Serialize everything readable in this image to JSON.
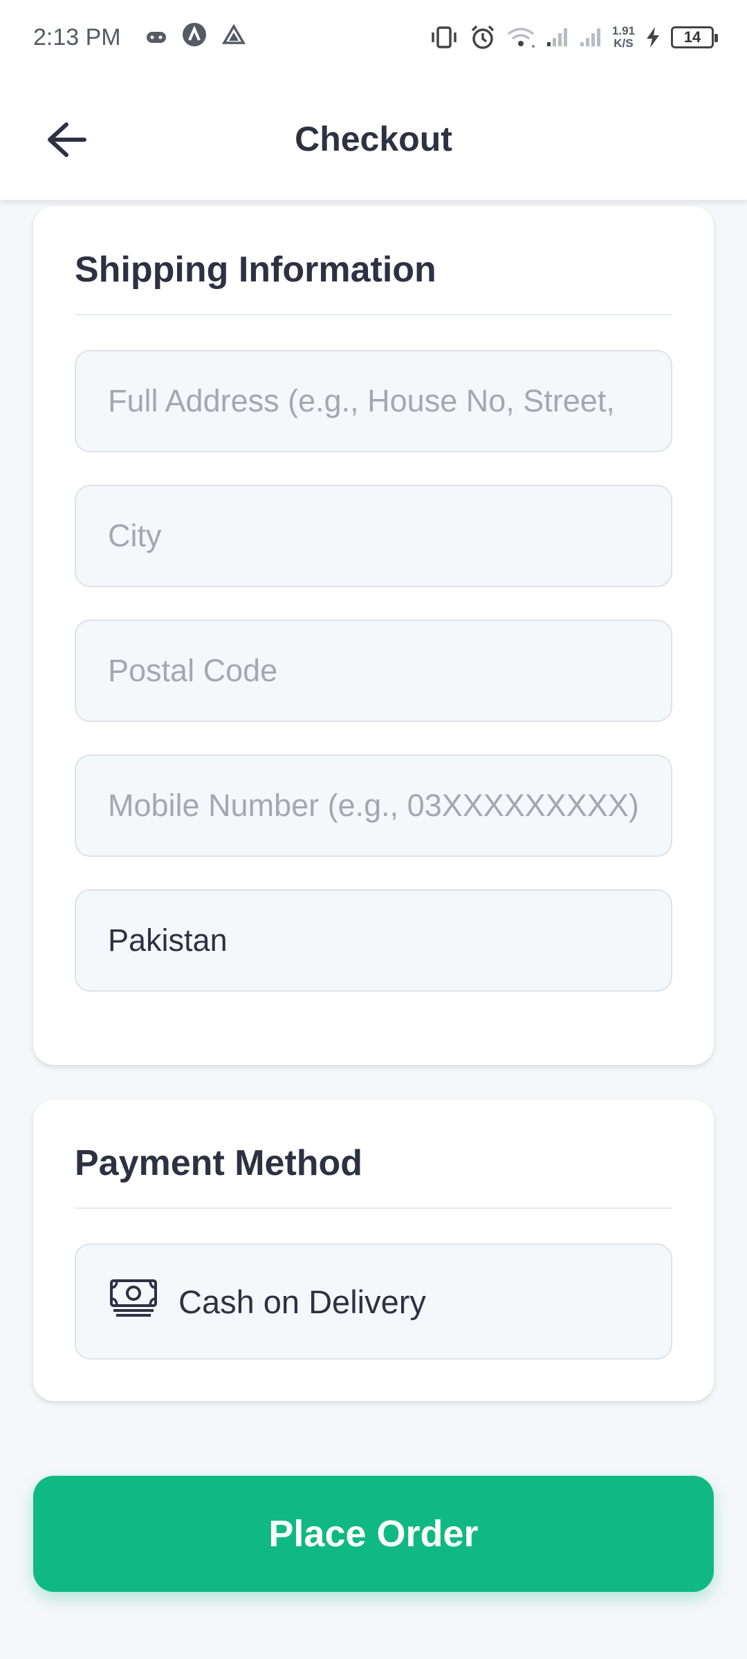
{
  "status_bar": {
    "time": "2:13 PM",
    "speed_value": "1.91",
    "speed_unit": "K/S",
    "battery": "14"
  },
  "header": {
    "title": "Checkout"
  },
  "shipping": {
    "title": "Shipping Information",
    "fields": [
      {
        "placeholder": "Full Address (e.g., House No, Street,",
        "value": ""
      },
      {
        "placeholder": "City",
        "value": ""
      },
      {
        "placeholder": "Postal Code",
        "value": ""
      },
      {
        "placeholder": "Mobile Number (e.g., 03XXXXXXXXX)",
        "value": ""
      },
      {
        "placeholder": "",
        "value": "Pakistan"
      }
    ]
  },
  "payment": {
    "title": "Payment Method",
    "option_label": "Cash on Delivery",
    "option_icon": "cash-icon"
  },
  "actions": {
    "place_order_label": "Place Order",
    "accent_color": "#10b981"
  }
}
